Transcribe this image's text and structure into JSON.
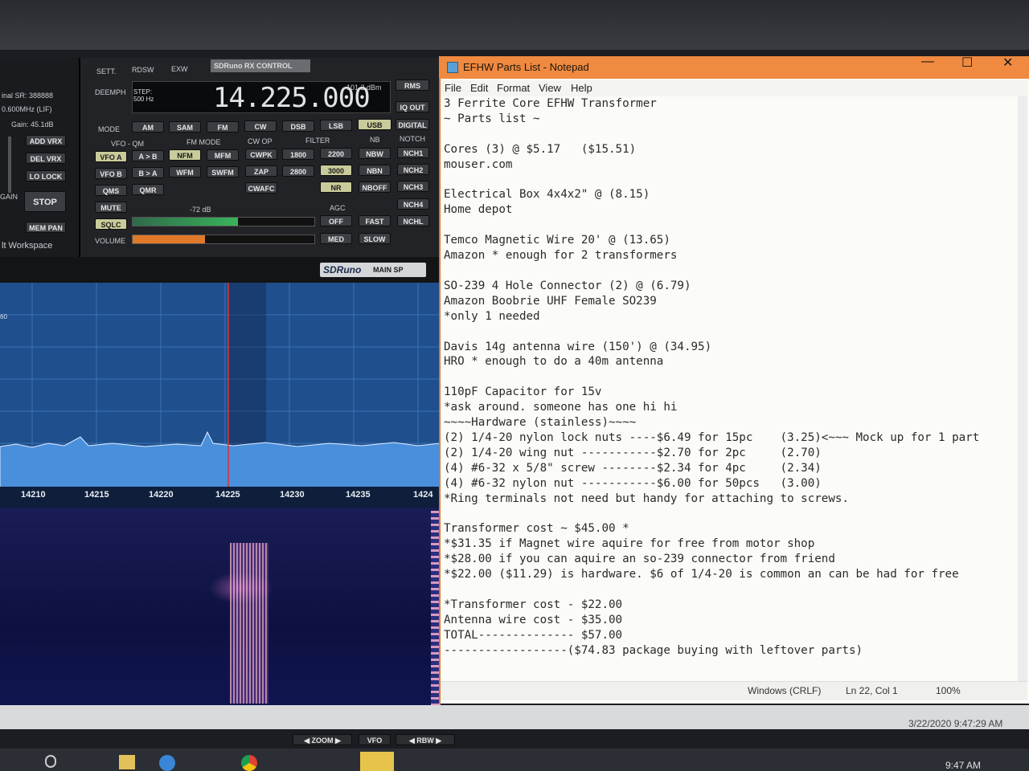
{
  "sdr_left": {
    "sr_label": "inal SR: 388888",
    "lif_label": "0.600MHz (LIF)",
    "gain_label": "Gain: 45.1dB",
    "buttons": [
      "ADD VRX",
      "DEL VRX",
      "LO LOCK",
      "STOP",
      "MEM PAN"
    ],
    "gain_side": "GAIN",
    "workspace": "lt Workspace"
  },
  "rx_control": {
    "tabs": [
      "SETT.",
      "RDSW",
      "EXW"
    ],
    "brand": "SDRuno RX CONTROL",
    "deemph": "DEEMPH",
    "step_label": "STEP:",
    "step_value": "500 Hz",
    "frequency": "14.225.000",
    "dbm": "-101.2 dBm",
    "rms": "RMS",
    "iq_out": "IQ OUT",
    "digital": "DIGITAL",
    "mode_label": "MODE",
    "modes": [
      "AM",
      "SAM",
      "FM",
      "CW",
      "DSB",
      "LSB",
      "USB"
    ],
    "vfo_qm_label": "VFO - QM",
    "fm_mode_label": "FM MODE",
    "cw_op_label": "CW OP",
    "filter_label": "FILTER",
    "nb_label": "NB",
    "notch_label": "NOTCH",
    "vfo_a": "VFO A",
    "a_to_b": "A > B",
    "vfo_b": "VFO B",
    "b_to_a": "B > A",
    "qms": "QMS",
    "qmr": "QMR",
    "fm_modes": [
      "NFM",
      "MFM",
      "WFM",
      "SWFM"
    ],
    "cw_ops": [
      "CWPK",
      "ZAP",
      "CWAFC"
    ],
    "filters": [
      "1800",
      "2200",
      "2800",
      "3000"
    ],
    "nb": [
      "NBW",
      "NBN",
      "NBOFF"
    ],
    "nr": "NR",
    "notches": [
      "NCH1",
      "NCH2",
      "NCH3",
      "NCH4",
      "NCHL"
    ],
    "mute": "MUTE",
    "sqlc": "SQLC",
    "volume": "VOLUME",
    "sqlc_db": "-72 dB",
    "agc_label": "AGC",
    "agc": [
      "OFF",
      "FAST",
      "MED",
      "SLOW"
    ],
    "meter_level": 0.58,
    "volume_level": 0.4
  },
  "main_sp": {
    "brand": "SDRuno",
    "title": "MAIN SP",
    "side_value": "60",
    "ticks": [
      "14210",
      "14215",
      "14220",
      "14225",
      "14230",
      "14235",
      "1424"
    ]
  },
  "notepad": {
    "title": "EFHW Parts List - Notepad",
    "menu": [
      "File",
      "Edit",
      "Format",
      "View",
      "Help"
    ],
    "lines": [
      "3 Ferrite Core EFHW Transformer",
      "~ Parts list ~",
      "",
      "Cores (3) @ $5.17   ($15.51)",
      "mouser.com",
      "",
      "Electrical Box 4x4x2\" @ (8.15)",
      "Home depot",
      "",
      "Temco Magnetic Wire 20' @ (13.65)",
      "Amazon * enough for 2 transformers",
      "",
      "SO-239 4 Hole Connector (2) @ (6.79)",
      "Amazon Boobrie UHF Female SO239",
      "*only 1 needed",
      "",
      "Davis 14g antenna wire (150') @ (34.95)",
      "HRO * enough to do a 40m antenna",
      "",
      "110pF Capacitor for 15v",
      "*ask around. someone has one hi hi",
      "~~~~Hardware (stainless)~~~~",
      "(2) 1/4-20 nylon lock nuts ----$6.49 for 15pc    (3.25)<~~~ Mock up for 1 part",
      "(2) 1/4-20 wing nut -----------$2.70 for 2pc     (2.70)",
      "(4) #6-32 x 5/8\" screw --------$2.34 for 4pc     (2.34)",
      "(4) #6-32 nylon nut -----------$6.00 for 50pcs   (3.00)",
      "*Ring terminals not need but handy for attaching to screws.",
      "",
      "Transformer cost ~ $45.00 *",
      "*$31.35 if Magnet wire aquire for free from motor shop",
      "*$28.00 if you can aquire an so-239 connector from friend",
      "*$22.00 ($11.29) is hardware. $6 of 1/4-20 is common an can be had for free",
      "",
      "*Transformer cost - $22.00",
      "Antenna wire cost - $35.00",
      "TOTAL-------------- $57.00",
      "------------------($74.83 package buying with leftover parts)"
    ],
    "status": {
      "eol": "Windows (CRLF)",
      "position": "Ln 22, Col 1",
      "zoom": "100%"
    }
  },
  "bottom": {
    "datetime": "3/22/2020 9:47:29 AM",
    "zoom": "ZOOM",
    "vfo": "VFO",
    "rbw": "RBW",
    "clock": "9:47 AM"
  }
}
